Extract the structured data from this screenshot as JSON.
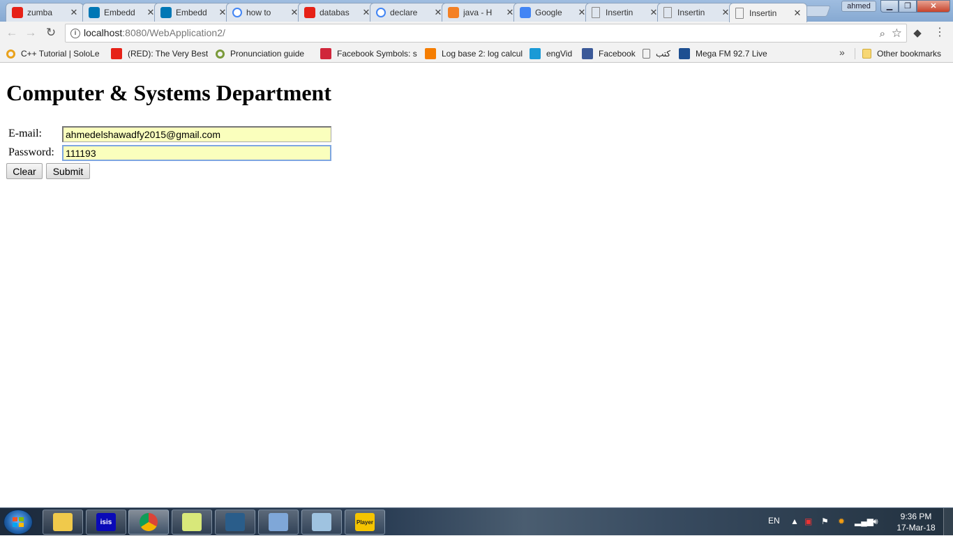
{
  "browser": {
    "tabs": [
      {
        "title": "zumba",
        "icon": "youtube-icon",
        "color": "#e62117"
      },
      {
        "title": "Embedd",
        "icon": "linkedin-icon",
        "color": "#0077b5"
      },
      {
        "title": "Embedd",
        "icon": "linkedin-icon",
        "color": "#0077b5"
      },
      {
        "title": "how to",
        "icon": "google-icon",
        "color": "#4285f4"
      },
      {
        "title": "databas",
        "icon": "youtube-icon",
        "color": "#e62117"
      },
      {
        "title": "declare",
        "icon": "google-icon",
        "color": "#4285f4"
      },
      {
        "title": "java - H",
        "icon": "stackoverflow-icon",
        "color": "#f48024"
      },
      {
        "title": "Google",
        "icon": "google-translate-icon",
        "color": "#4285f4"
      },
      {
        "title": "Insertin",
        "icon": "page-icon",
        "color": "#888888"
      },
      {
        "title": "Insertin",
        "icon": "page-icon",
        "color": "#888888"
      },
      {
        "title": "Insertin",
        "icon": "page-icon",
        "color": "#888888",
        "active": true
      }
    ],
    "tab_close": "✕",
    "profile_name": "ahmed",
    "window_min": "▁",
    "window_max": "❐",
    "window_close": "✕",
    "url_host": "localhost",
    "url_rest": ":8080/WebApplication2/",
    "bookmarks": [
      {
        "label": "C++ Tutorial | SoloLe",
        "icon": "sololearn-icon",
        "color": "#e9a21c"
      },
      {
        "label": "(RED): The Very Best",
        "icon": "youtube-icon",
        "color": "#e62117"
      },
      {
        "label": "Pronunciation guide",
        "icon": "forvo-icon",
        "color": "#7a9a3a"
      },
      {
        "label": "Facebook Symbols: s",
        "icon": "lightning-icon",
        "color": "#d0263b"
      },
      {
        "label": "Log base 2: log calcul",
        "icon": "blogger-icon",
        "color": "#f57d00"
      },
      {
        "label": "engVid",
        "icon": "engvid-icon",
        "color": "#1a9ad6"
      },
      {
        "label": "Facebook",
        "icon": "facebook-icon",
        "color": "#3b5998"
      },
      {
        "label": "كتب",
        "icon": "page-icon",
        "color": "#888888"
      },
      {
        "label": "Mega FM 92.7 Live",
        "icon": "bars-icon",
        "color": "#1d4f91"
      }
    ],
    "bookmarks_more": "»",
    "other_bookmarks": "Other bookmarks"
  },
  "page": {
    "title": "Computer & Systems Department",
    "email_label": "E-mail:",
    "email_value": "ahmedelshawadfy2015@gmail.com",
    "password_label": "Password:",
    "password_value": "111193",
    "clear_label": "Clear",
    "submit_label": "Submit"
  },
  "taskbar": {
    "apps": [
      {
        "name": "file-explorer",
        "label": ""
      },
      {
        "name": "isis-app",
        "label": "isis"
      },
      {
        "name": "chrome",
        "label": ""
      },
      {
        "name": "sticky-notes",
        "label": ""
      },
      {
        "name": "mysql-workbench",
        "label": ""
      },
      {
        "name": "virtualbox",
        "label": ""
      },
      {
        "name": "notepad",
        "label": ""
      },
      {
        "name": "kmplayer",
        "label": "Player"
      }
    ],
    "language": "EN",
    "time": "9:36 PM",
    "date": "17-Mar-18"
  }
}
